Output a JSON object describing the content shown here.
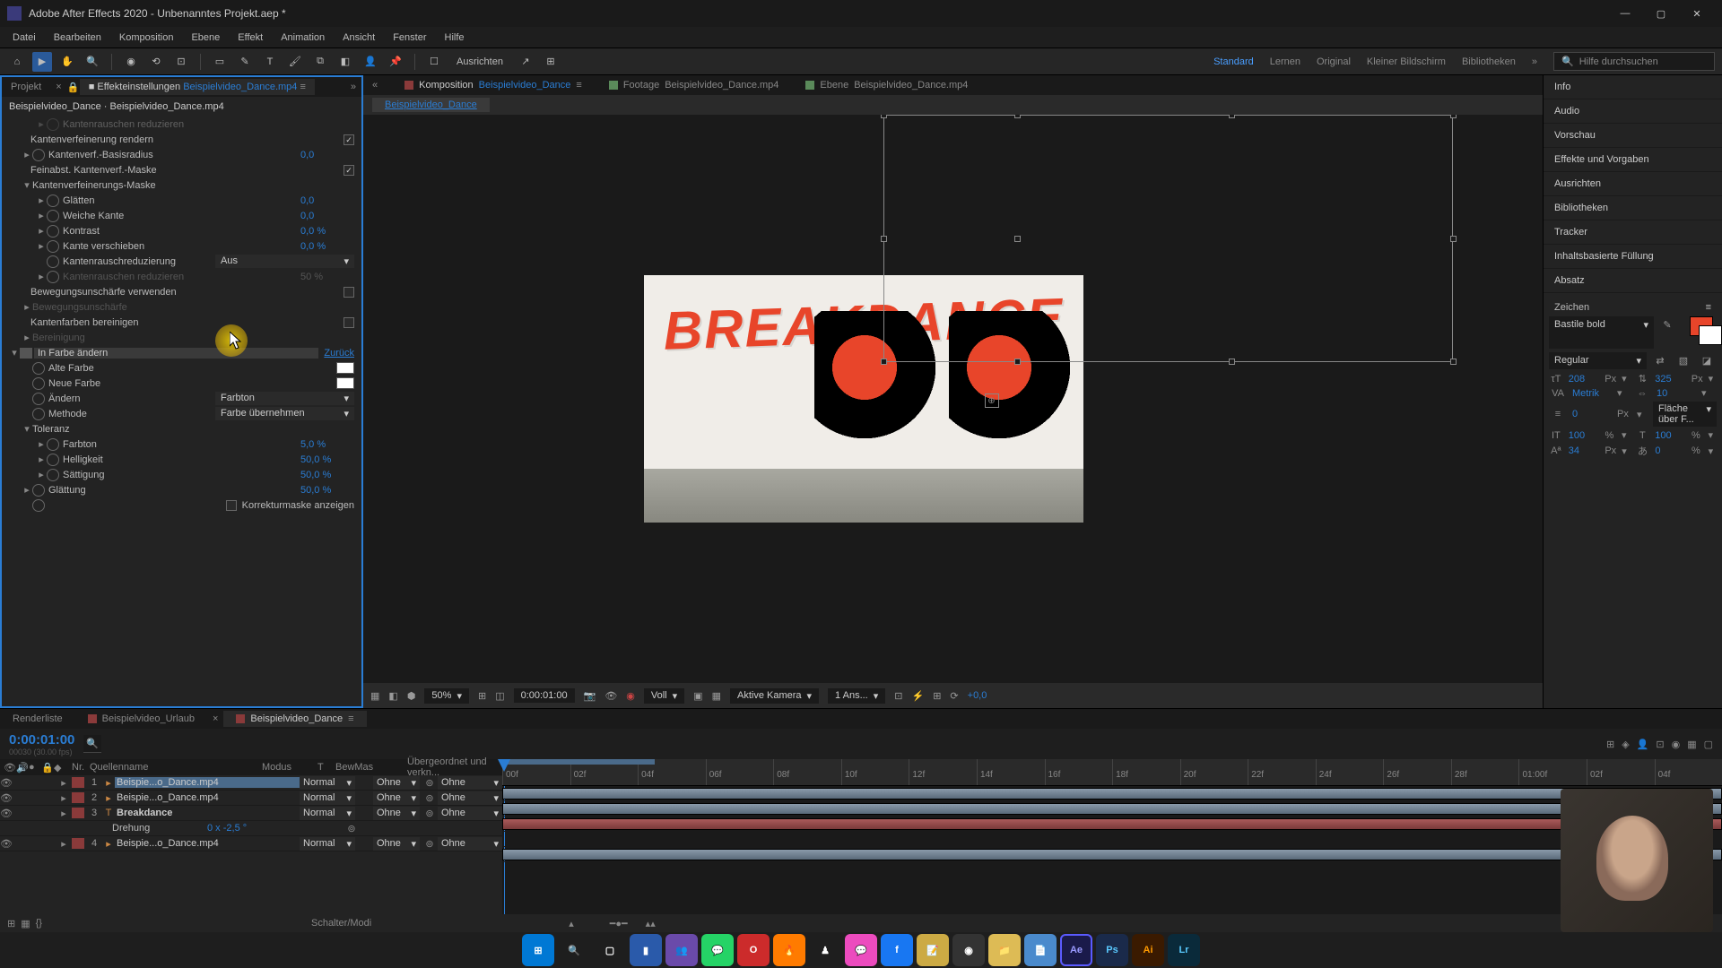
{
  "titlebar": {
    "title": "Adobe After Effects 2020 - Unbenanntes Projekt.aep *"
  },
  "menu": [
    "Datei",
    "Bearbeiten",
    "Komposition",
    "Ebene",
    "Effekt",
    "Animation",
    "Ansicht",
    "Fenster",
    "Hilfe"
  ],
  "toolbar": {
    "align": "Ausrichten",
    "searchplaceholder": "Hilfe durchsuchen"
  },
  "workspaces": [
    "Standard",
    "Lernen",
    "Original",
    "Kleiner Bildschirm",
    "Bibliotheken"
  ],
  "leftpanel": {
    "tab_project": "Projekt",
    "tab_effects": "Effekteinstellungen",
    "tab_layer": "Beispielvideo_Dance.mp4",
    "breadcrumb": "Beispielvideo_Dance · Beispielvideo_Dance.mp4",
    "rows": {
      "kantenraus": "Kantenrauschen reduzieren",
      "kantenverf_render": "Kantenverfeinerung rendern",
      "kantenverf_basis": "Kantenverf.-Basisradius",
      "kbv": "0,0",
      "feinabst": "Feinabst. Kantenverf.-Maske",
      "kvm": "Kantenverfeinerungs-Maske",
      "glatten": "Glätten",
      "glv": "0,0",
      "weichekante": "Weiche Kante",
      "wkv": "0,0",
      "kontrast": "Kontrast",
      "kov": "0,0 %",
      "kantevers": "Kante verschieben",
      "kvv": "0,0 %",
      "kantenraus2": "Kantenrauschreduzierung",
      "kr2v": "Aus",
      "kantenraus3": "Kantenrauschen reduzieren",
      "kr3v": "50 %",
      "bewegung": "Bewegungsunschärfe verwenden",
      "bewegung2": "Bewegungsunschärfe",
      "kantenfarb": "Kantenfarben bereinigen",
      "bereinigung": "Bereinigung",
      "infarbe": "In Farbe ändern",
      "reset": "Zurück",
      "altefarbe": "Alte Farbe",
      "neuefarbe": "Neue Farbe",
      "aendern": "Ändern",
      "aendv": "Farbton",
      "methode": "Methode",
      "methv": "Farbe übernehmen",
      "toleranz": "Toleranz",
      "farbton": "Farbton",
      "farbtv": "5,0 %",
      "helligkeit": "Helligkeit",
      "hellv": "50,0 %",
      "saettigung": "Sättigung",
      "saettv": "50,0 %",
      "glaettung": "Glättung",
      "glaettv": "50,0 %",
      "korrektur": "Korrekturmaske anzeigen"
    }
  },
  "center": {
    "tabs": {
      "komp": "Komposition",
      "komp_name": "Beispielvideo_Dance",
      "footage": "Footage",
      "footage_name": "Beispielvideo_Dance.mp4",
      "ebene": "Ebene",
      "ebene_name": "Beispielvideo_Dance.mp4"
    },
    "subtab": "Beispielvideo_Dance",
    "canvastext": "BREAKDANCE"
  },
  "viewfooter": {
    "mag": "50%",
    "time": "0:00:01:00",
    "res": "Voll",
    "cam": "Aktive Kamera",
    "views": "1 Ans...",
    "exp": "+0,0"
  },
  "rightpanels": [
    "Info",
    "Audio",
    "Vorschau",
    "Effekte und Vorgaben",
    "Ausrichten",
    "Bibliotheken",
    "Tracker",
    "Inhaltsbasierte Füllung",
    "Absatz"
  ],
  "char": {
    "title": "Zeichen",
    "font": "Bastile bold",
    "style": "Regular",
    "size": "208",
    "size_u": "Px",
    "leading": "325",
    "leading_u": "Px",
    "kerning": "Metrik",
    "tracking": "10",
    "stroke": "0",
    "stroke_u": "Px",
    "filllabel": "Fläche über F...",
    "vscale": "100",
    "hscale": "100",
    "pct": "%",
    "baseline": "34",
    "bl_u": "Px",
    "tsume": "0"
  },
  "bottom": {
    "tab_render": "Renderliste",
    "tab_urlaub": "Beispielvideo_Urlaub",
    "tab_dance": "Beispielvideo_Dance",
    "timecode": "0:00:01:00",
    "fps": "00030 (30.00 fps)",
    "cols": {
      "nr": "Nr.",
      "src": "Quellenname",
      "mode": "Modus",
      "t": "T",
      "bewmas": "BewMas",
      "parent": "Übergeordnet und verkn..."
    },
    "layers": [
      {
        "n": "1",
        "name": "Beispie...o_Dance.mp4",
        "mode": "Normal",
        "bm": "Ohne",
        "p": "Ohne",
        "sel": true,
        "ic": "vid"
      },
      {
        "n": "2",
        "name": "Beispie...o_Dance.mp4",
        "mode": "Normal",
        "bm": "Ohne",
        "p": "Ohne",
        "ic": "vid"
      },
      {
        "n": "3",
        "name": "Breakdance",
        "mode": "Normal",
        "bm": "Ohne",
        "p": "Ohne",
        "ic": "txt"
      },
      {
        "n": "4",
        "name": "Beispie...o_Dance.mp4",
        "mode": "Normal",
        "bm": "Ohne",
        "p": "Ohne",
        "ic": "vid"
      }
    ],
    "prop": {
      "name": "Drehung",
      "val": "0 x -2,5 °"
    },
    "ticks": [
      "00f",
      "02f",
      "04f",
      "06f",
      "08f",
      "10f",
      "12f",
      "14f",
      "16f",
      "18f",
      "20f",
      "22f",
      "24f",
      "26f",
      "28f",
      "01:00f",
      "02f",
      "04f"
    ],
    "schalter": "Schalter/Modi"
  }
}
